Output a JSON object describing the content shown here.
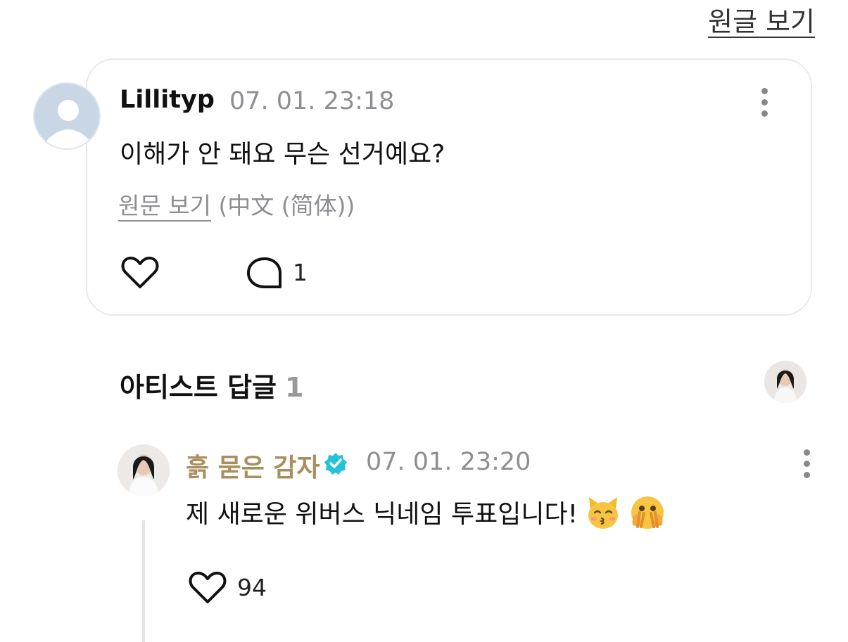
{
  "header": {
    "view_original": "원글 보기"
  },
  "post": {
    "author": "Lillityp",
    "date": "07. 01. 23:18",
    "text": "이해가 안 돼요 무슨 선거예요?",
    "translate_link": "원문 보기",
    "translate_lang": "(中文 (简体))",
    "comment_count": "1"
  },
  "artist_replies": {
    "heading": "아티스트 답글",
    "count": "1"
  },
  "reply": {
    "author": "흙 묻은 감자",
    "date": "07. 01. 23:20",
    "text": "제 새로운 위버스 닉네임 투표입니다!",
    "like_count": "94"
  },
  "colors": {
    "artist_name": "#a98f5d",
    "verified": "#22c3d6",
    "muted": "#8e8e93"
  }
}
